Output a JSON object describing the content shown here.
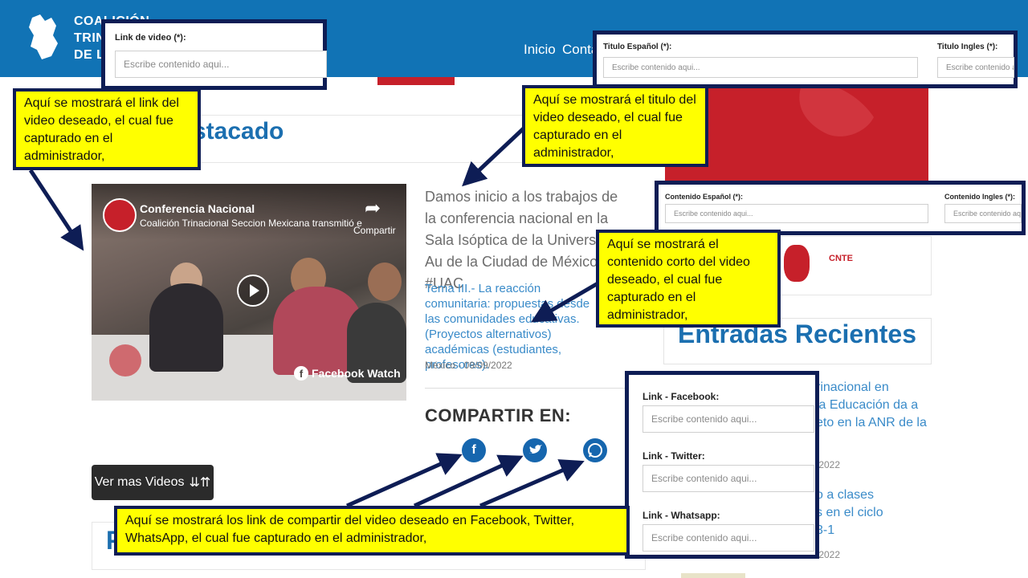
{
  "header": {
    "logo_lines": [
      "COALICIÓN",
      "TRINA",
      "DE LA"
    ],
    "nav": [
      "Inicio",
      "Contá"
    ]
  },
  "main": {
    "section_heading_partial": "stacado",
    "video": {
      "overlay_title": "Conferencia Nacional",
      "overlay_sub": "Coalición Trinacional Seccion Mexicana transmitió e",
      "share_label": "Compartir",
      "watch_label": "Facebook Watch"
    },
    "video_title": "Damos inicio a los trabajos de la conferencia nacional en la Sala Isóptica de la Universidad Au de la Ciudad de México #UAC",
    "video_desc": "Tema III.- La reacción comunitaria: propuestas desde las comunidades educativas. (Proyectos alternativos) académicas (estudiantes, profesores).",
    "video_date": "México - 09/09/2022",
    "compartir": "COMPARTIR EN:",
    "social_icons": [
      "facebook-icon",
      "twitter-icon",
      "whatsapp-icon"
    ],
    "ver_mas": "Ver mas Videos",
    "bottom_heading_partial": "P"
  },
  "sidebar": {
    "entradas": "Entradas Recientes",
    "recent": [
      {
        "text": [
          "rinacional en",
          "la Educación da a",
          "eto en la ANR de la"
        ],
        "date": "/2022"
      },
      {
        "text": [
          "o a clases",
          "s en el ciclo",
          "3-1"
        ],
        "date": "/2022"
      }
    ]
  },
  "admin_panels": {
    "link_video": {
      "label": "Link de video (*):",
      "placeholder": "Escribe contenido aqui..."
    },
    "titulo": {
      "es_label": "Titulo Español (*):",
      "es_placeholder": "Escribe contenido aqui...",
      "en_label": "Titulo Ingles (*):",
      "en_placeholder": "Escribe contenido aqui..."
    },
    "contenido": {
      "es_label": "Contenido Español (*):",
      "es_placeholder": "Escribe contenido aqui...",
      "en_label": "Contenido Ingles (*):",
      "en_placeholder": "Escribe contenido aqui..."
    },
    "links": {
      "facebook_label": "Link - Facebook:",
      "facebook_placeholder": "Escribe contenido aqui...",
      "twitter_label": "Link - Twitter:",
      "twitter_placeholder": "Escribe contenido aqui...",
      "whatsapp_label": "Link - Whatsapp:",
      "whatsapp_placeholder": "Escribe contenido aqui..."
    }
  },
  "notes": {
    "link": "Aquí se mostrará el link del video deseado, el cual fue capturado en el administrador,",
    "titulo": "Aquí se mostrará el titulo del video deseado, el cual fue capturado en el administrador,",
    "contenido": "Aquí se mostrará el contenido corto del video deseado, el cual fue capturado en el administrador,",
    "compartir": "Aquí se mostrará los link de compartir  del video deseado en Facebook, Twitter, WhatsApp,  el cual fue capturado en el administrador,"
  },
  "colors": {
    "header_blue": "#1173b5",
    "accent_red": "#c6202a",
    "annotation_navy": "#0e1d55",
    "note_yellow": "#ffff00",
    "link_blue": "#3a8bc9"
  }
}
